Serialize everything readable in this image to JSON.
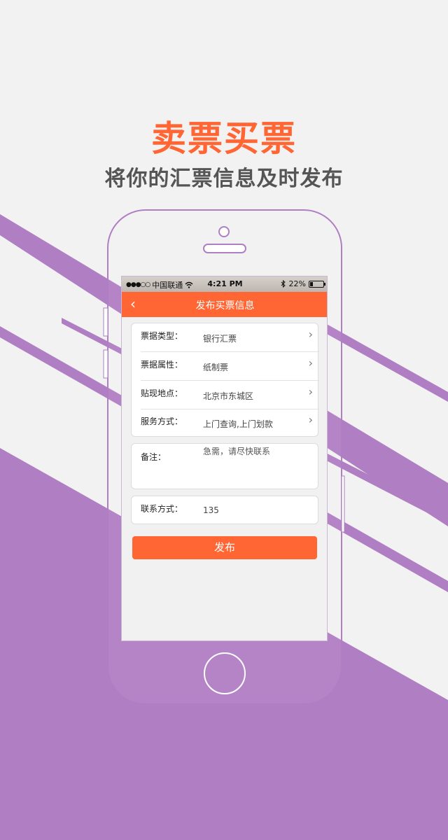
{
  "colors": {
    "accent": "#ff6633",
    "purple": "#b07ec3",
    "background": "#f2f2f2",
    "subtitle": "#555555"
  },
  "promo": {
    "headline": "卖票买票",
    "subline": "将你的汇票信息及时发布"
  },
  "status_bar": {
    "signal": "●●●○○",
    "carrier": "中国联通",
    "wifi_icon": "wifi-icon",
    "time": "4:21 PM",
    "bluetooth_icon": "bluetooth-icon",
    "battery_text": "22%",
    "battery_level": 0.22
  },
  "navbar": {
    "back_icon": "chevron-left-icon",
    "title": "发布买票信息"
  },
  "form": {
    "rows": [
      {
        "label": "票据类型：",
        "value": "银行汇票"
      },
      {
        "label": "票据属性：",
        "value": "纸制票"
      },
      {
        "label": "贴现地点：",
        "value": "北京市东城区"
      },
      {
        "label": "服务方式：",
        "value": "上门查询,上门划款"
      }
    ],
    "note": {
      "label": "备注：",
      "value": "急需，请尽快联系"
    },
    "contact": {
      "label": "联系方式：",
      "value": "135"
    },
    "submit_label": "发布"
  }
}
